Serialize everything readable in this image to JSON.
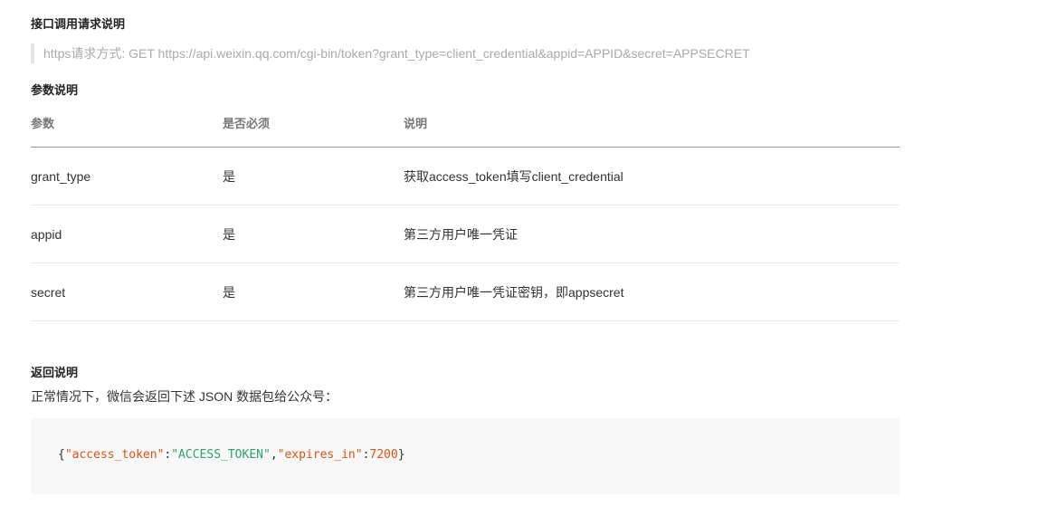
{
  "sections": {
    "request_heading": "接口调用请求说明",
    "request_quote": "https请求方式: GET https://api.weixin.qq.com/cgi-bin/token?grant_type=client_credential&appid=APPID&secret=APPSECRET",
    "params_heading": "参数说明",
    "return_heading": "返回说明",
    "return_text": "正常情况下，微信会返回下述 JSON 数据包给公众号："
  },
  "table": {
    "headers": [
      "参数",
      "是否必须",
      "说明"
    ],
    "rows": [
      [
        "grant_type",
        "是",
        "获取access_token填写client_credential"
      ],
      [
        "appid",
        "是",
        "第三方用户唯一凭证"
      ],
      [
        "secret",
        "是",
        "第三方用户唯一凭证密钥，即appsecret"
      ]
    ]
  },
  "code": {
    "open": "{",
    "key1": "\"access_token\"",
    "colon1": ":",
    "val1": "\"ACCESS_TOKEN\"",
    "comma": ",",
    "key2": "\"expires_in\"",
    "colon2": ":",
    "val2": "7200",
    "close": "}"
  },
  "colors": {
    "key": "#e4500e",
    "string": "#2aa56a"
  }
}
